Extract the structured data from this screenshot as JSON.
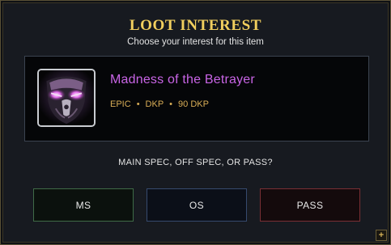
{
  "dialog": {
    "title": "LOOT INTEREST",
    "subtitle": "Choose your interest for this item"
  },
  "item": {
    "name": "Madness of the Betrayer",
    "icon": "demon-face-icon",
    "rarity": "EPIC",
    "type": "DKP",
    "cost": "90 DKP",
    "separator": "•",
    "name_color": "#c965e6",
    "meta_color": "#d9ad56"
  },
  "prompt": "MAIN SPEC, OFF SPEC, OR PASS?",
  "buttons": {
    "ms": "MS",
    "os": "OS",
    "pass": "PASS"
  },
  "corner_button": "+",
  "colors": {
    "title": "#f1cf5e",
    "ms_border": "#3f6b47",
    "os_border": "#364a6e",
    "pass_border": "#7a2f34"
  }
}
